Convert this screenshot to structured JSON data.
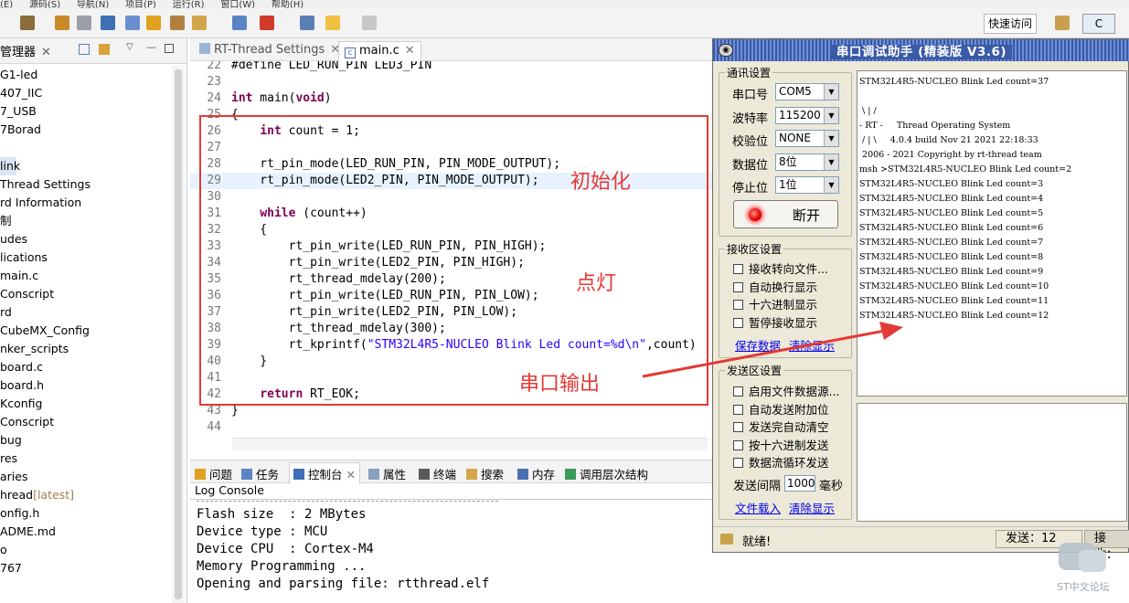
{
  "menubar": [
    "(E)",
    "源码(S)",
    "导航(N)",
    "项目(P)",
    "运行(R)",
    "窗口(W)",
    "帮助(H)"
  ],
  "toolbar": {
    "quick_access": "快速访问",
    "perspective": "C"
  },
  "left_panel": {
    "tab_label": "管理器",
    "items": [
      "G1-led",
      "407_IIC",
      "7_USB",
      "7Borad",
      "",
      "link",
      "Thread Settings",
      "rd Information",
      "制",
      "udes",
      "lications",
      "main.c",
      "Conscript",
      "rd",
      "CubeMX_Config",
      "nker_scripts",
      "board.c",
      "board.h",
      "Kconfig",
      "Conscript",
      "bug",
      "res",
      "aries",
      "hread",
      "onfig.h",
      "ADME.md",
      "o",
      "767"
    ],
    "latest_tag": "[latest]"
  },
  "editor": {
    "tabs": [
      "RT-Thread Settings",
      "main.c"
    ],
    "lines": [
      {
        "n": "22",
        "t": "#define LED_RUN_PIN LED3_PIN"
      },
      {
        "n": "23",
        "t": ""
      },
      {
        "n": "24",
        "t": "int main(void)"
      },
      {
        "n": "25",
        "t": "{"
      },
      {
        "n": "26",
        "t": "    int count = 1;"
      },
      {
        "n": "27",
        "t": ""
      },
      {
        "n": "28",
        "t": "    rt_pin_mode(LED_RUN_PIN, PIN_MODE_OUTPUT);"
      },
      {
        "n": "29",
        "t": "    rt_pin_mode(LED2_PIN, PIN_MODE_OUTPUT);"
      },
      {
        "n": "30",
        "t": ""
      },
      {
        "n": "31",
        "t": "    while (count++)"
      },
      {
        "n": "32",
        "t": "    {"
      },
      {
        "n": "33",
        "t": "        rt_pin_write(LED_RUN_PIN, PIN_HIGH);"
      },
      {
        "n": "34",
        "t": "        rt_pin_write(LED2_PIN, PIN_HIGH);"
      },
      {
        "n": "35",
        "t": "        rt_thread_mdelay(200);"
      },
      {
        "n": "36",
        "t": "        rt_pin_write(LED_RUN_PIN, PIN_LOW);"
      },
      {
        "n": "37",
        "t": "        rt_pin_write(LED2_PIN, PIN_LOW);"
      },
      {
        "n": "38",
        "t": "        rt_thread_mdelay(300);"
      },
      {
        "n": "39",
        "t": "        rt_kprintf(\"STM32L4R5-NUCLEO Blink Led count=%d\\n\",count)"
      },
      {
        "n": "40",
        "t": "    }"
      },
      {
        "n": "41",
        "t": ""
      },
      {
        "n": "42",
        "t": "    return RT_EOK;"
      },
      {
        "n": "43",
        "t": "}"
      },
      {
        "n": "44",
        "t": ""
      }
    ]
  },
  "annotations": {
    "init": "初始化",
    "blink": "点灯",
    "serial_out": "串口输出"
  },
  "console": {
    "tabs": [
      "问题",
      "任务",
      "控制台",
      "属性",
      "终端",
      "搜索",
      "内存",
      "调用层次结构"
    ],
    "title": "Log Console",
    "lines": [
      "Flash size  : 2 MBytes",
      "Device type : MCU",
      "Device CPU  : Cortex-M4",
      "Memory Programming ...",
      "Opening and parsing file: rtthread.elf"
    ]
  },
  "serial": {
    "title": "串口调试助手 (精装版 V3.6)",
    "comm_group": "通讯设置",
    "fields": [
      {
        "label": "串口号",
        "value": "COM5"
      },
      {
        "label": "波特率",
        "value": "115200"
      },
      {
        "label": "校验位",
        "value": "NONE"
      },
      {
        "label": "数据位",
        "value": "8位"
      },
      {
        "label": "停止位",
        "value": "1位"
      }
    ],
    "disconnect": "断开",
    "recv_group": "接收区设置",
    "recv_options": [
      "接收转向文件...",
      "自动换行显示",
      "十六进制显示",
      "暂停接收显示"
    ],
    "recv_links": [
      "保存数据",
      "清除显示"
    ],
    "send_group": "发送区设置",
    "send_options": [
      "启用文件数据源...",
      "自动发送附加位",
      "发送完自动清空",
      "按十六进制发送",
      "数据流循环发送"
    ],
    "interval_label": "发送间隔",
    "interval_value": "1000",
    "interval_unit": "毫秒",
    "send_links": [
      "文件载入",
      "清除显示"
    ],
    "recv_lines": [
      "STM32L4R5-NUCLEO Blink Led count=37",
      "",
      " \\ | /",
      "- RT -     Thread Operating System",
      " / | \\     4.0.4 build Nov 21 2021 22:18:33",
      " 2006 - 2021 Copyright by rt-thread team",
      "msh >STM32L4R5-NUCLEO Blink Led count=2",
      "STM32L4R5-NUCLEO Blink Led count=3",
      "STM32L4R5-NUCLEO Blink Led count=4",
      "STM32L4R5-NUCLEO Blink Led count=5",
      "STM32L4R5-NUCLEO Blink Led count=6",
      "STM32L4R5-NUCLEO Blink Led count=7",
      "STM32L4R5-NUCLEO Blink Led count=8",
      "STM32L4R5-NUCLEO Blink Led count=9",
      "STM32L4R5-NUCLEO Blink Led count=10",
      "STM32L4R5-NUCLEO Blink Led count=11",
      "STM32L4R5-NUCLEO Blink Led count=12"
    ],
    "status": "就绪!",
    "send_count": "发送：12",
    "recv_count": "接收："
  },
  "watermark": "ST中文论坛",
  "colors": {
    "annotation_red": "#e53935",
    "keyword": "#7f0055",
    "string": "#2a00ff",
    "title_blue": "#3a5aa8"
  }
}
